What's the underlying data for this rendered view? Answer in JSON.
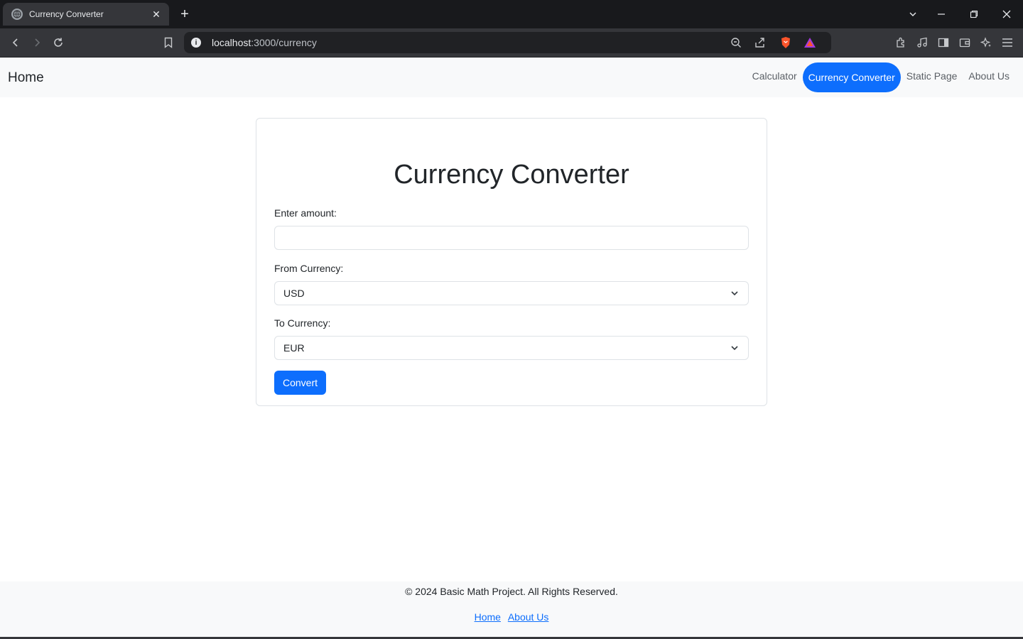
{
  "browser": {
    "tab_title": "Currency Converter",
    "url_host": "localhost",
    "url_path": ":3000/currency"
  },
  "navbar": {
    "brand": "Home",
    "links": [
      {
        "label": "Calculator"
      },
      {
        "label": "Currency Converter"
      },
      {
        "label": "Static Page"
      },
      {
        "label": "About Us"
      }
    ]
  },
  "form": {
    "title": "Currency Converter",
    "amount_label": "Enter amount:",
    "amount_value": "",
    "from_label": "From Currency:",
    "from_value": "USD",
    "to_label": "To Currency:",
    "to_value": "EUR",
    "convert_label": "Convert"
  },
  "footer": {
    "copyright": "© 2024 Basic Math Project. All Rights Reserved.",
    "links": [
      {
        "label": "Home"
      },
      {
        "label": "About Us"
      }
    ]
  },
  "colors": {
    "primary": "#0d6efd",
    "navbar_bg": "#f8f9fa",
    "chrome_dark": "#18191c"
  }
}
